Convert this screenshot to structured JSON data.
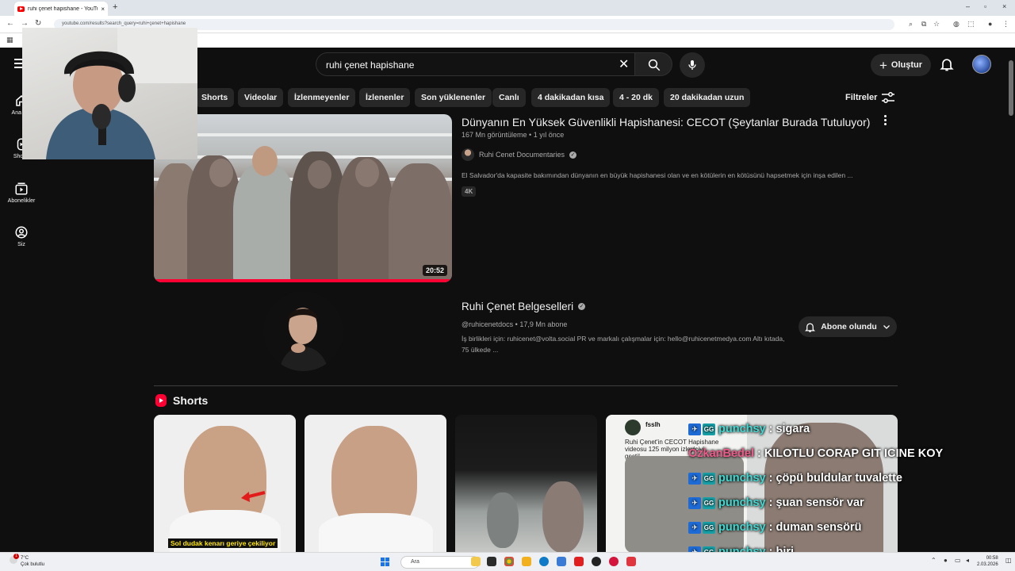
{
  "browser": {
    "tab_title": "ruhi çenet hapishane - YouTube",
    "tab_close": "×",
    "new_tab": "+",
    "url": "youtube.com/results?search_query=ruhi+çenet+hapishane",
    "window_controls": [
      "–",
      "▫",
      "×"
    ]
  },
  "header": {
    "search_value": "ruhi çenet hapishane",
    "clear_symbol": "✕",
    "create_label": "Oluştur",
    "create_plus": "+"
  },
  "sidebar": {
    "items": [
      {
        "label": "Ana S..."
      },
      {
        "label": "Shorts"
      },
      {
        "label": "Abonelikler"
      },
      {
        "label": "Siz"
      }
    ]
  },
  "chips": [
    "Shorts",
    "Videolar",
    "İzlenmeyenler",
    "İzlenenler",
    "Son yüklenenler",
    "Canlı",
    "4 dakikadan kısa",
    "4 - 20 dk",
    "20 dakikadan uzun"
  ],
  "filters_label": "Filtreler",
  "video": {
    "title": "Dünyanın En Yüksek Güvenlikli Hapishanesi: CECOT (Şeytanlar Burada Tutuluyor)",
    "meta": "167 Mn görüntüleme • 1 yıl önce",
    "channel": "Ruhi Cenet Documentaries",
    "description": "El Salvador'da kapasite bakımından dünyanın en büyük hapishanesi olan ve en kötülerin en kötüsünü hapsetmek için inşa edilen ...",
    "badge": "4K",
    "duration": "20:52"
  },
  "channel_card": {
    "name": "Ruhi Çenet Belgeselleri",
    "meta": "@ruhicenetdocs • 17,9 Mn abone",
    "description": "İş birlikleri için: ruhicenet@volta.social PR ve markalı çalışmalar için: hello@ruhicenetmedya.com Altı kıtada, 75 ülkede ...",
    "subscribe_label": "Abone olundu"
  },
  "shorts": {
    "heading": "Shorts",
    "caption": "Sol dudak kenarı geriye çekiliyor",
    "card4_user": "fsslh",
    "card4_text": "Ruhi Çenet'in CECOT Hapishane videosu 125 milyon izleyiciyi geçti!"
  },
  "chat": [
    {
      "user": "punchsy",
      "sep": " : ",
      "msg": "sigara"
    },
    {
      "user": "OzkanBedel",
      "sep": " : ",
      "msg": "KILOTLU CORAP GIT ICINE KOY"
    },
    {
      "user": "punchsy",
      "sep": " : ",
      "msg": "çöpü buldular tuvalette"
    },
    {
      "user": "punchsy",
      "sep": " : ",
      "msg": "şuan sensör var"
    },
    {
      "user": "punchsy",
      "sep": " : ",
      "msg": "duman sensörü"
    },
    {
      "user": "punchsy",
      "sep": " : ",
      "msg": "biri"
    }
  ],
  "taskbar": {
    "temp": "7°C",
    "weather": "Çok bulutlu",
    "weather_badge": "1",
    "search_placeholder": "Ara",
    "time": "00:58",
    "date": "2.03.2026"
  },
  "colors": {
    "accent": "#ff0033",
    "chat_user": "#3fd9d2",
    "chat_user_alt": "#f05a8a"
  }
}
